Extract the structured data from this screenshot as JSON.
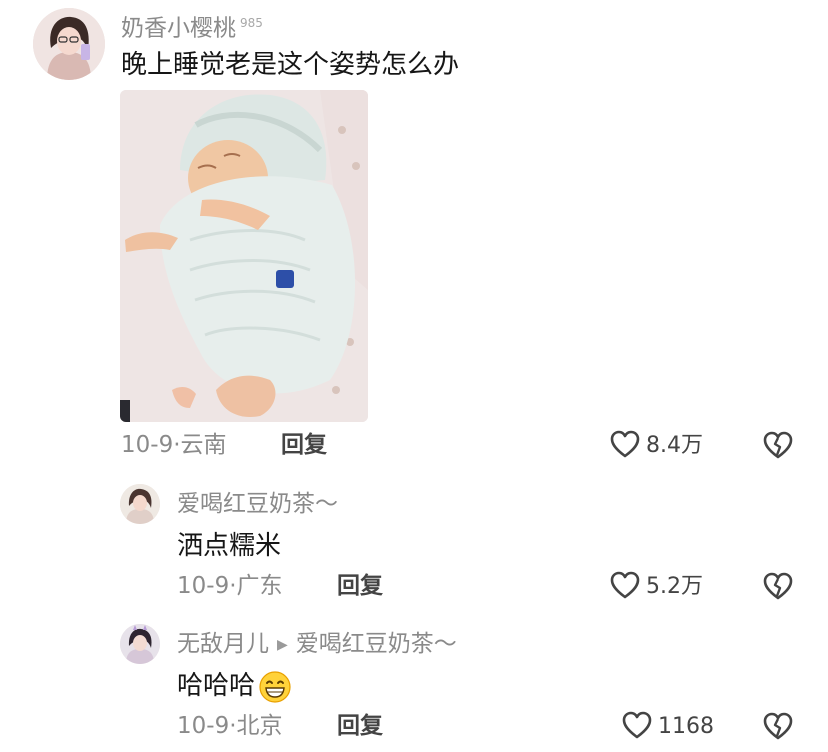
{
  "comments": [
    {
      "username": "奶香小樱桃",
      "level_badge": "985",
      "text": "晚上睡觉老是这个姿势怎么办",
      "date": "10-9",
      "location": "云南",
      "reply_label": "回复",
      "likes": "8.4万"
    },
    {
      "username": "爱喝红豆奶茶～",
      "text": "洒点糯米",
      "date": "10-9",
      "location": "广东",
      "reply_label": "回复",
      "likes": "5.2万"
    },
    {
      "username": "无敌月儿",
      "reply_to": "爱喝红豆奶茶～",
      "text": "哈哈哈",
      "date": "10-9",
      "location": "北京",
      "reply_label": "回复",
      "likes": "1168"
    }
  ],
  "meta_separator": "·",
  "icons": {
    "like": "heart-outline-icon",
    "dislike": "broken-heart-icon",
    "reply_arrow": "triangle-right-icon",
    "emoji": "grinning-face-emoji"
  },
  "colors": {
    "text_primary": "#161616",
    "text_secondary": "#8a8a8a",
    "action_text": "#444444"
  }
}
